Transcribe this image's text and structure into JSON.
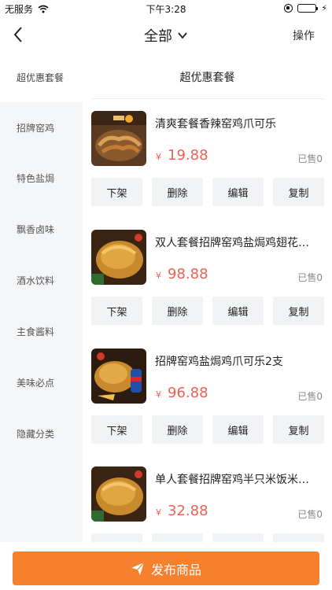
{
  "status_bar": {
    "carrier": "无服务",
    "time": "下午3:28"
  },
  "nav": {
    "title": "全部",
    "action": "操作"
  },
  "sidebar": {
    "items": [
      {
        "label": "超优惠套餐"
      },
      {
        "label": "招牌窑鸡"
      },
      {
        "label": "特色盐焗"
      },
      {
        "label": "飘香卤味"
      },
      {
        "label": "酒水饮料"
      },
      {
        "label": "主食酱料"
      },
      {
        "label": "美味必点"
      },
      {
        "label": "隐藏分类"
      }
    ]
  },
  "section": {
    "title": "超优惠套餐"
  },
  "actions": {
    "unshelve": "下架",
    "delete": "删除",
    "edit": "编辑",
    "copy": "复制"
  },
  "products": [
    {
      "name": "清爽套餐香辣窑鸡爪可乐",
      "currency": "¥",
      "price": "19.88",
      "sold": "已售0"
    },
    {
      "name": "双人套餐招牌窑鸡盐焗鸡翅花…",
      "currency": "¥",
      "price": "98.88",
      "sold": "已售0"
    },
    {
      "name": "招牌窑鸡盐焗鸡爪可乐2支",
      "currency": "¥",
      "price": "96.88",
      "sold": "已售0"
    },
    {
      "name": "单人套餐招牌窑鸡半只米饭米…",
      "currency": "¥",
      "price": "32.88",
      "sold": "已售0"
    }
  ],
  "publish": {
    "label": "发布商品"
  },
  "colors": {
    "accent": "#f5812f",
    "price": "#ef5f53",
    "sidebar_bg": "#f5f6f8",
    "button_bg": "#f1f3f5"
  },
  "icons": [
    "wifi-icon",
    "lock-rotation-icon",
    "battery-icon",
    "back-icon",
    "chevron-down-icon",
    "send-icon"
  ]
}
